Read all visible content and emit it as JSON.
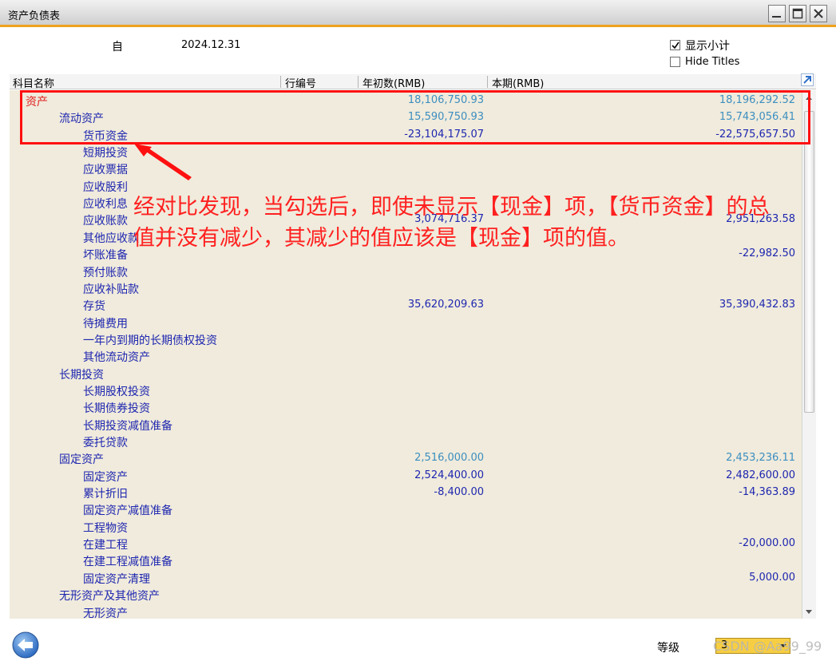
{
  "window": {
    "title": "资产负债表"
  },
  "header": {
    "from_label": "自",
    "date": "2024.12.31",
    "show_subtotal_label": "显示小计",
    "show_subtotal_checked": true,
    "hide_titles_label": "Hide Titles",
    "hide_titles_checked": false
  },
  "columns": {
    "name": "科目名称",
    "row_no": "行编号",
    "opening": "年初数(RMB)",
    "current": "本期(RMB)"
  },
  "rows": [
    {
      "name": "资产",
      "level": 0,
      "opening": "18,106,750.93",
      "current": "18,196,292.52",
      "style": "red-light"
    },
    {
      "name": "流动资产",
      "level": 1,
      "opening": "15,590,750.93",
      "current": "15,743,056.41",
      "style": "light"
    },
    {
      "name": "货币资金",
      "level": 2,
      "opening": "-23,104,175.07",
      "current": "-22,575,657.50",
      "style": "dark"
    },
    {
      "name": "短期投资",
      "level": 2,
      "opening": "",
      "current": "",
      "style": "dark"
    },
    {
      "name": "应收票据",
      "level": 2,
      "opening": "",
      "current": "",
      "style": "dark"
    },
    {
      "name": "应收股利",
      "level": 2,
      "opening": "",
      "current": "",
      "style": "dark"
    },
    {
      "name": "应收利息",
      "level": 2,
      "opening": "",
      "current": "",
      "style": "dark"
    },
    {
      "name": "应收账款",
      "level": 2,
      "opening": "3,074,716.37",
      "current": "2,951,263.58",
      "style": "dark"
    },
    {
      "name": "其他应收款",
      "level": 2,
      "opening": "",
      "current": "",
      "style": "dark"
    },
    {
      "name": "坏账准备",
      "level": 2,
      "opening": "",
      "current": "-22,982.50",
      "style": "dark"
    },
    {
      "name": "预付账款",
      "level": 2,
      "opening": "",
      "current": "",
      "style": "dark"
    },
    {
      "name": "应收补贴款",
      "level": 2,
      "opening": "",
      "current": "",
      "style": "dark"
    },
    {
      "name": "存货",
      "level": 2,
      "opening": "35,620,209.63",
      "current": "35,390,432.83",
      "style": "dark"
    },
    {
      "name": "待摊费用",
      "level": 2,
      "opening": "",
      "current": "",
      "style": "dark"
    },
    {
      "name": "一年内到期的长期债权投资",
      "level": 2,
      "opening": "",
      "current": "",
      "style": "dark"
    },
    {
      "name": "其他流动资产",
      "level": 2,
      "opening": "",
      "current": "",
      "style": "dark"
    },
    {
      "name": "长期投资",
      "level": 1,
      "opening": "",
      "current": "",
      "style": "dark"
    },
    {
      "name": "长期股权投资",
      "level": 2,
      "opening": "",
      "current": "",
      "style": "dark"
    },
    {
      "name": "长期债券投资",
      "level": 2,
      "opening": "",
      "current": "",
      "style": "dark"
    },
    {
      "name": "长期投资减值准备",
      "level": 2,
      "opening": "",
      "current": "",
      "style": "dark"
    },
    {
      "name": "委托贷款",
      "level": 2,
      "opening": "",
      "current": "",
      "style": "dark"
    },
    {
      "name": "固定资产",
      "level": 1,
      "opening": "2,516,000.00",
      "current": "2,453,236.11",
      "style": "light"
    },
    {
      "name": "固定资产",
      "level": 2,
      "opening": "2,524,400.00",
      "current": "2,482,600.00",
      "style": "dark"
    },
    {
      "name": "累计折旧",
      "level": 2,
      "opening": "-8,400.00",
      "current": "-14,363.89",
      "style": "dark"
    },
    {
      "name": "固定资产减值准备",
      "level": 2,
      "opening": "",
      "current": "",
      "style": "dark"
    },
    {
      "name": "工程物资",
      "level": 2,
      "opening": "",
      "current": "",
      "style": "dark"
    },
    {
      "name": "在建工程",
      "level": 2,
      "opening": "",
      "current": "-20,000.00",
      "style": "dark"
    },
    {
      "name": "在建工程减值准备",
      "level": 2,
      "opening": "",
      "current": "",
      "style": "dark"
    },
    {
      "name": "固定资产清理",
      "level": 2,
      "opening": "",
      "current": "5,000.00",
      "style": "dark"
    },
    {
      "name": "无形资产及其他资产",
      "level": 1,
      "opening": "",
      "current": "",
      "style": "dark"
    },
    {
      "name": "无形资产",
      "level": 2,
      "opening": "",
      "current": "",
      "style": "dark"
    }
  ],
  "annotation": {
    "line1": "经对比发现，当勾选后，即使未显示【现金】项，【货币资金】的总",
    "line2": "值并没有减少，其减少的值应该是【现金】项的值。",
    "color": "#ff2020"
  },
  "footer": {
    "level_label": "等级",
    "level_value": "3",
    "watermark": "CSDN @Aa99_99"
  },
  "icons": {
    "minimize": "minimize-icon",
    "maximize": "maximize-icon",
    "close": "close-icon",
    "back": "back-arrow-icon",
    "expand": "expand-arrow-icon"
  }
}
